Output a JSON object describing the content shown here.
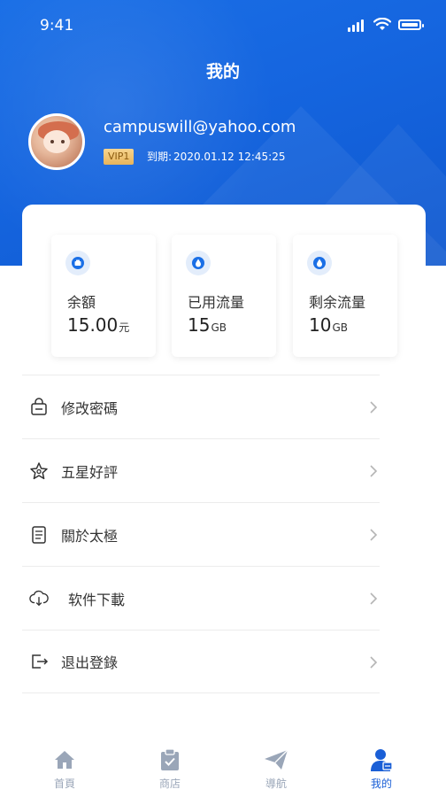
{
  "status_bar": {
    "time": "9:41"
  },
  "header": {
    "title": "我的"
  },
  "profile": {
    "email": "campuswill@yahoo.com",
    "vip_badge": "VIP1",
    "expire_label": "到期:",
    "expire_value": "2020.01.12 12:45:25"
  },
  "stats": [
    {
      "label": "余額",
      "value": "15.00",
      "unit": "元",
      "icon": "wallet-icon"
    },
    {
      "label": "已用流量",
      "value": "15",
      "unit": "GB",
      "icon": "water-drop-icon"
    },
    {
      "label": "剩余流量",
      "value": "10",
      "unit": "GB",
      "icon": "water-drop-icon"
    }
  ],
  "menu": [
    {
      "label": "修改密碼",
      "icon": "lock-icon"
    },
    {
      "label": "五星好評",
      "icon": "star-icon"
    },
    {
      "label": "關於太極",
      "icon": "document-icon"
    },
    {
      "label": "软件下載",
      "icon": "cloud-download-icon"
    },
    {
      "label": "退出登錄",
      "icon": "logout-icon"
    }
  ],
  "tabs": [
    {
      "label": "首頁",
      "icon": "home-icon",
      "active": false
    },
    {
      "label": "商店",
      "icon": "clipboard-icon",
      "active": false
    },
    {
      "label": "導航",
      "icon": "paper-plane-icon",
      "active": false
    },
    {
      "label": "我的",
      "icon": "user-icon",
      "active": true
    }
  ],
  "colors": {
    "primary": "#1a6fe6",
    "active_tab": "#1a5fd6",
    "inactive_tab": "#9aa6b8",
    "vip_gold": "#e7b45b"
  }
}
